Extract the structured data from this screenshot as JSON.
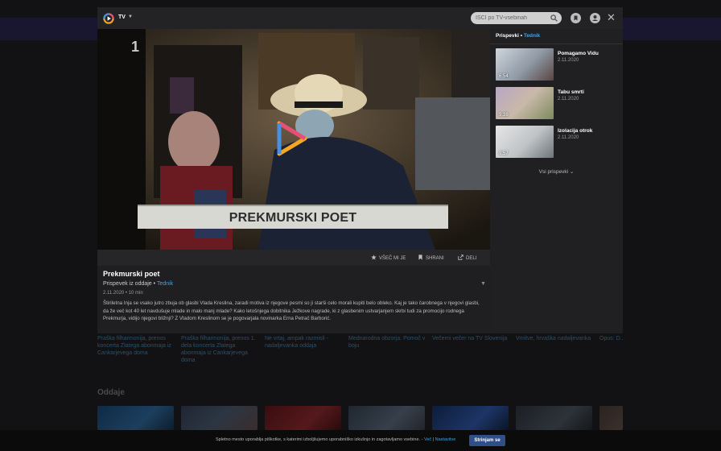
{
  "header": {
    "brand_label": "TV",
    "search_placeholder": "IŠČI po TV-vsebinah"
  },
  "video": {
    "channel_badge": "1",
    "lower_third": "PREKMURSKI POET"
  },
  "actions": {
    "like": "VŠEČ MI JE",
    "save": "SHRANI",
    "share": "DELI"
  },
  "episode": {
    "title": "Prekmurski poet",
    "subtitle_prefix": "Prispevek iz oddaje",
    "show_link": "Tednik",
    "date": "2.11.2020",
    "duration": "10 min",
    "description": "Štiriletna Inja se vsako jutro zbuja ob glasbi Vlada Kreslina, zaradi motiva iz njegove pesmi so ji starši celo morali kupiti belo obleko. Kaj je tako čarobnega v njegovi glasbi, da že več kot 40 let navdušuje mlade in malo manj mlade? Kako letošnjega dobitnika Ježkove nagrade, ki z glasbenim ustvarjanjem skrbi tudi za promocijo rodnega Prekmurja, vidijo njegovi bližnji? Z Vladom Kreslinom se je pogovarjala novinarka Erna Petrač Barborić."
  },
  "sidebar": {
    "header_label": "Prispevki",
    "header_link": "Tednik",
    "items": [
      {
        "title": "Pomagamo Vidu",
        "date": "2.11.2020",
        "duration": "6:54"
      },
      {
        "title": "Tabu smrti",
        "date": "2.11.2020",
        "duration": "9:38"
      },
      {
        "title": "Izolacija otrok",
        "date": "2.11.2020",
        "duration": "9:57"
      }
    ],
    "all_posts": "Vsi prispevki"
  },
  "background": {
    "strip": [
      "Praška filharmonija, prenos koncerta Zlatega abonmaja iz Cankarjevega doma",
      "Praška filharmonija, prenos 1. dela koncerta Zlatega abonmaja iz Cankarjevega doma",
      "Ne vrtaj, ampak razmisli - nadaljevanka oddaja",
      "Mednarodna obzorja: Pomoč v boju",
      "Večerni večer na TV Slovenija",
      "Vrnitve, hrvaška nadaljevanka",
      "Opus: D..."
    ],
    "section_title": "Oddaje"
  },
  "cookie": {
    "text": "Spletno mesto uporablja piškotke, s katerimi izboljšujemo uporabniško izkušnjo in zagotavljamo vsebine. -",
    "more_link": "Več",
    "settings_link": "Nastavitve",
    "accept_label": "Strinjam se"
  },
  "colors": {
    "accent": "#3ba3e6",
    "button": "#2f4f86"
  }
}
